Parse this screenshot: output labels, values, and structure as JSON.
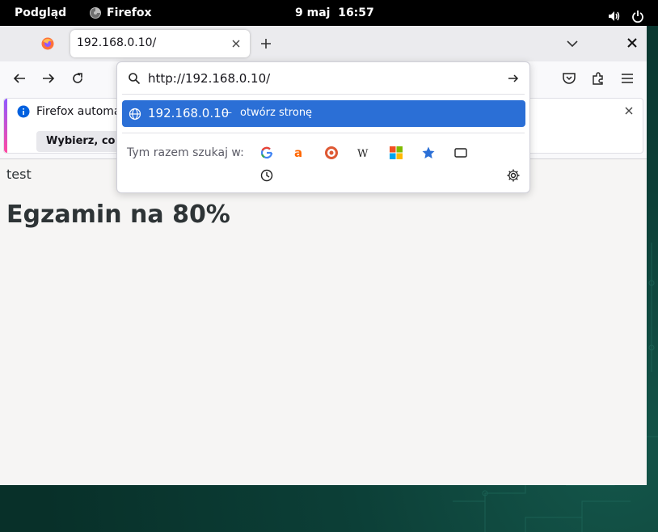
{
  "topbar": {
    "activities": "Podgląd",
    "app_name": "Firefox",
    "date": "9 maj",
    "time": "16:57"
  },
  "tabs": {
    "active_title": "192.168.0.10/"
  },
  "notification": {
    "text": "Firefox automat",
    "button_label": "Wybierz, co ud"
  },
  "page": {
    "text": "test",
    "heading": "Egzamin na 80%"
  },
  "urlbar": {
    "value": "http://192.168.0.10/",
    "result_url": "192.168.0.10",
    "result_separator": "—",
    "result_action": "otwórz stronę",
    "search_with_label": "Tym razem szukaj w:"
  },
  "colors": {
    "accent": "#2b6fd6",
    "topbar": "#000000",
    "desktop": "#0c3f37"
  },
  "icons": {
    "engines": [
      "google-icon",
      "amazon-icon",
      "duckduckgo-icon",
      "wikipedia-icon",
      "windows-icon",
      "bookmarks-star-icon",
      "tabs-icon"
    ],
    "history": "history-icon",
    "settings": "gear-icon"
  }
}
